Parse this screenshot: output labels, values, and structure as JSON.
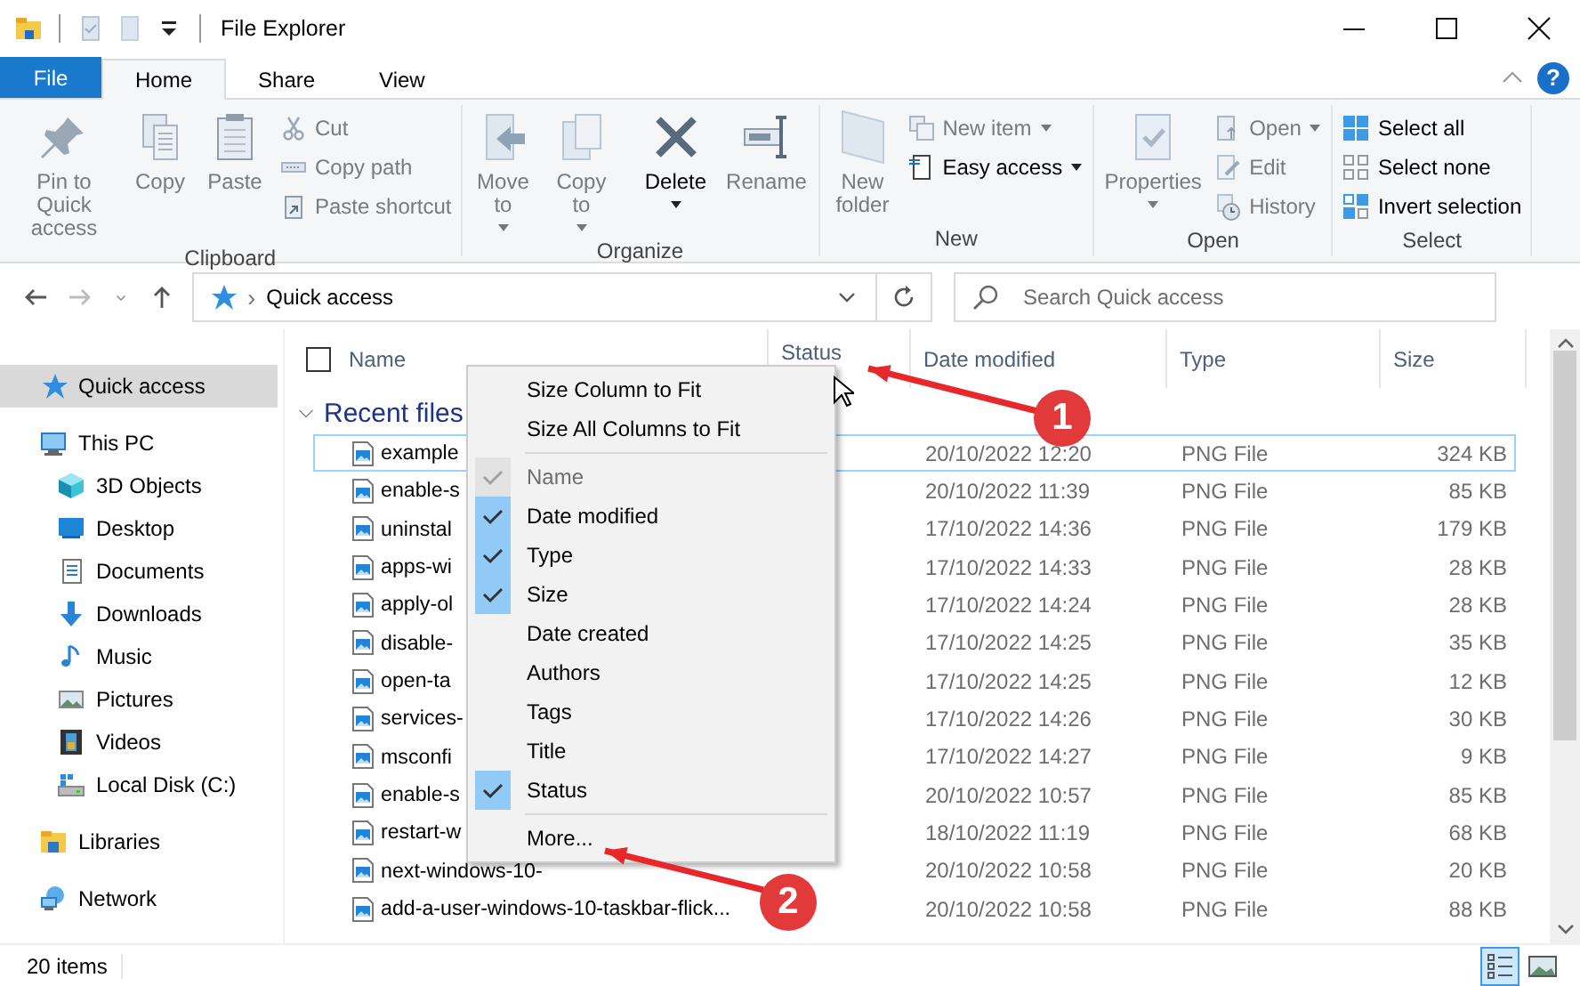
{
  "window": {
    "title": "File Explorer",
    "help": "?"
  },
  "ribbon_tabs": [
    {
      "label": "File",
      "kind": "file",
      "selected": false
    },
    {
      "label": "Home",
      "kind": "tab",
      "selected": true
    },
    {
      "label": "Share",
      "kind": "tab",
      "selected": false
    },
    {
      "label": "View",
      "kind": "tab",
      "selected": false
    }
  ],
  "ribbon_groups": [
    {
      "label": "Clipboard",
      "large": [
        {
          "label": "Pin to Quick access",
          "disabled": true,
          "dropdown": false
        },
        {
          "label": "Copy",
          "disabled": true,
          "dropdown": false
        },
        {
          "label": "Paste",
          "disabled": true,
          "dropdown": false
        }
      ],
      "small": [
        {
          "label": "Cut",
          "disabled": true,
          "dropdown": false
        },
        {
          "label": "Copy path",
          "disabled": true,
          "dropdown": false
        },
        {
          "label": "Paste shortcut",
          "disabled": true,
          "dropdown": false
        }
      ]
    },
    {
      "label": "Organize",
      "large": [
        {
          "label": "Move to",
          "disabled": true,
          "dropdown": true
        },
        {
          "label": "Copy to",
          "disabled": true,
          "dropdown": true
        },
        {
          "label": "Delete",
          "disabled": false,
          "dropdown": true
        },
        {
          "label": "Rename",
          "disabled": true,
          "dropdown": false
        }
      ]
    },
    {
      "label": "New",
      "large": [
        {
          "label": "New folder",
          "disabled": true,
          "dropdown": false
        }
      ],
      "small": [
        {
          "label": "New item",
          "disabled": true,
          "dropdown": true
        },
        {
          "label": "Easy access",
          "disabled": false,
          "dropdown": true
        }
      ]
    },
    {
      "label": "Open",
      "large": [
        {
          "label": "Properties",
          "disabled": true,
          "dropdown": true
        }
      ],
      "small": [
        {
          "label": "Open",
          "disabled": true,
          "dropdown": true
        },
        {
          "label": "Edit",
          "disabled": true,
          "dropdown": false
        },
        {
          "label": "History",
          "disabled": true,
          "dropdown": false
        }
      ]
    },
    {
      "label": "Select",
      "small": [
        {
          "label": "Select all",
          "disabled": false,
          "dropdown": false
        },
        {
          "label": "Select none",
          "disabled": false,
          "dropdown": false
        },
        {
          "label": "Invert selection",
          "disabled": false,
          "dropdown": false
        }
      ]
    }
  ],
  "address": {
    "separator": "›",
    "path": "Quick access"
  },
  "search": {
    "placeholder": "Search Quick access"
  },
  "sidebar": {
    "items": [
      {
        "label": "Quick access",
        "selected": true
      },
      {
        "label": "This PC",
        "selected": false,
        "children": [
          {
            "label": "3D Objects",
            "selected": false
          },
          {
            "label": "Desktop",
            "selected": false
          },
          {
            "label": "Documents",
            "selected": false
          },
          {
            "label": "Downloads",
            "selected": false
          },
          {
            "label": "Music",
            "selected": false
          },
          {
            "label": "Pictures",
            "selected": false
          },
          {
            "label": "Videos",
            "selected": false
          },
          {
            "label": "Local Disk (C:)",
            "selected": false
          }
        ]
      },
      {
        "label": "Libraries",
        "selected": false
      },
      {
        "label": "Network",
        "selected": false
      }
    ]
  },
  "table": {
    "select_all": {
      "checked": false
    },
    "columns": [
      {
        "label": "Name"
      },
      {
        "label": "Status"
      },
      {
        "label": "Date modified"
      },
      {
        "label": "Type"
      },
      {
        "label": "Size"
      }
    ],
    "group": {
      "label": "Recent files",
      "expanded": true
    },
    "rows": [
      {
        "name": "example",
        "date": "20/10/2022 12:20",
        "type": "PNG File",
        "size": "324 KB",
        "focused": true
      },
      {
        "name": "enable-s",
        "date": "20/10/2022 11:39",
        "type": "PNG File",
        "size": "85 KB",
        "focused": false
      },
      {
        "name": "uninstal",
        "date": "17/10/2022 14:36",
        "type": "PNG File",
        "size": "179 KB",
        "focused": false
      },
      {
        "name": "apps-wi",
        "date": "17/10/2022 14:33",
        "type": "PNG File",
        "size": "28 KB",
        "focused": false
      },
      {
        "name": "apply-ol",
        "date": "17/10/2022 14:24",
        "type": "PNG File",
        "size": "28 KB",
        "focused": false
      },
      {
        "name": "disable-",
        "date": "17/10/2022 14:25",
        "type": "PNG File",
        "size": "35 KB",
        "focused": false
      },
      {
        "name": "open-ta",
        "date": "17/10/2022 14:25",
        "type": "PNG File",
        "size": "12 KB",
        "focused": false
      },
      {
        "name": "services-",
        "date": "17/10/2022 14:26",
        "type": "PNG File",
        "size": "30 KB",
        "focused": false
      },
      {
        "name": "msconfi",
        "date": "17/10/2022 14:27",
        "type": "PNG File",
        "size": "9 KB",
        "focused": false
      },
      {
        "name": "enable-s",
        "date": "20/10/2022 10:57",
        "type": "PNG File",
        "size": "85 KB",
        "focused": false
      },
      {
        "name": "restart-w",
        "date": "18/10/2022 11:19",
        "type": "PNG File",
        "size": "68 KB",
        "focused": false
      },
      {
        "name": "next-windows-10-",
        "date": "20/10/2022 10:58",
        "type": "PNG File",
        "size": "20 KB",
        "focused": false
      },
      {
        "name": "add-a-user-windows-10-taskbar-flick...",
        "date": "20/10/2022 10:58",
        "type": "PNG File",
        "size": "88 KB",
        "focused": false
      }
    ]
  },
  "context_menu": {
    "items": [
      {
        "kind": "action",
        "label": "Size Column to Fit",
        "checked": false,
        "disabled": false
      },
      {
        "kind": "action",
        "label": "Size All Columns to Fit",
        "checked": false,
        "disabled": false
      },
      {
        "kind": "separator"
      },
      {
        "kind": "check",
        "label": "Name",
        "checked": true,
        "disabled": true
      },
      {
        "kind": "check",
        "label": "Date modified",
        "checked": true,
        "disabled": false
      },
      {
        "kind": "check",
        "label": "Type",
        "checked": true,
        "disabled": false
      },
      {
        "kind": "check",
        "label": "Size",
        "checked": true,
        "disabled": false
      },
      {
        "kind": "check",
        "label": "Date created",
        "checked": false,
        "disabled": false
      },
      {
        "kind": "check",
        "label": "Authors",
        "checked": false,
        "disabled": false
      },
      {
        "kind": "check",
        "label": "Tags",
        "checked": false,
        "disabled": false
      },
      {
        "kind": "check",
        "label": "Title",
        "checked": false,
        "disabled": false
      },
      {
        "kind": "check",
        "label": "Status",
        "checked": true,
        "disabled": false
      },
      {
        "kind": "separator"
      },
      {
        "kind": "action",
        "label": "More...",
        "checked": false,
        "disabled": false
      }
    ]
  },
  "annotations": [
    {
      "label": "1"
    },
    {
      "label": "2"
    }
  ],
  "status_bar": {
    "count": "20 items",
    "views": [
      {
        "selected": true
      },
      {
        "selected": false
      }
    ]
  }
}
